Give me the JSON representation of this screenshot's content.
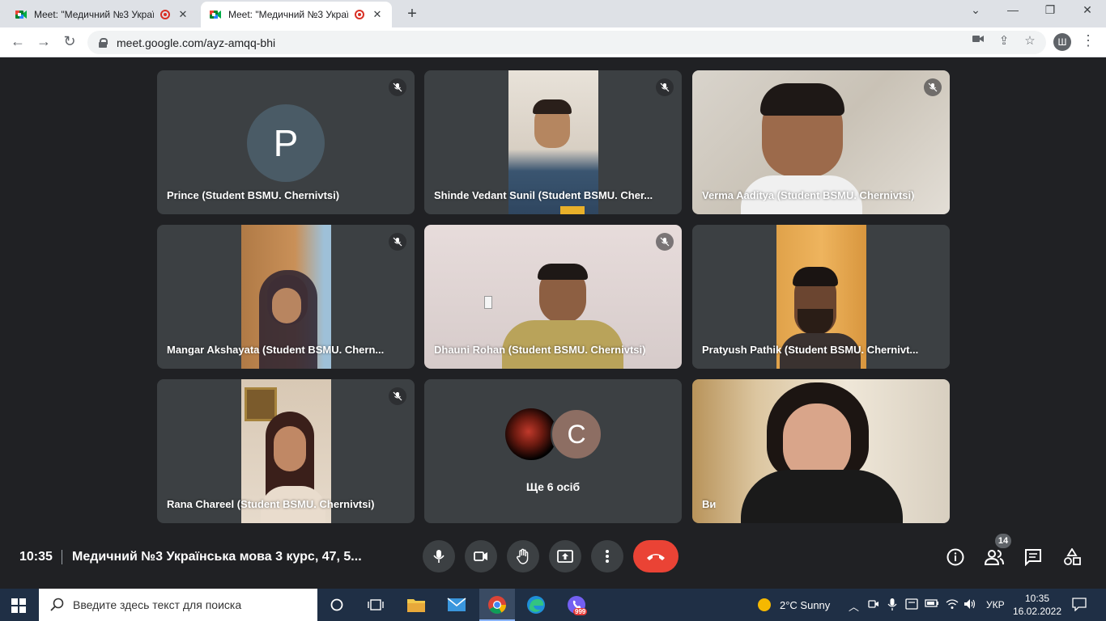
{
  "browser": {
    "tabs": [
      {
        "title": "Meet: \"Медичний №3 Украї"
      },
      {
        "title": "Meet: \"Медичний №3 Украї"
      }
    ],
    "url": "meet.google.com/ayz-amqq-bhi",
    "profile_initial": "Ш"
  },
  "meet": {
    "tiles": [
      {
        "name": "Prince (Student BSMU. Chernivtsi)",
        "avatar": "P",
        "muted": true
      },
      {
        "name": "Shinde Vedant Sunil (Student BSMU. Cher...",
        "muted": true
      },
      {
        "name": "Verma Aaditya (Student BSMU. Chernivtsi)",
        "muted": true
      },
      {
        "name": "Mangar Akshayata (Student BSMU. Chern...",
        "muted": true
      },
      {
        "name": "Dhauni Rohan (Student BSMU. Chernivtsi)",
        "muted": true
      },
      {
        "name": "Pratyush Pathik (Student BSMU. Chernivt...",
        "muted": false
      },
      {
        "name": "Rana Chareel (Student BSMU. Chernivtsi)",
        "muted": true
      },
      {
        "name": "Ще 6 осіб",
        "avatar": "C"
      },
      {
        "name": "Ви"
      }
    ],
    "bottom": {
      "time": "10:35",
      "meeting_title": "Медичний №3 Українська мова 3 курс, 47, 5...",
      "participants_count": "14"
    }
  },
  "taskbar": {
    "search_placeholder": "Введите здесь текст для поиска",
    "weather": "2°C  Sunny",
    "lang": "УКР",
    "time": "10:35",
    "date": "16.02.2022",
    "viber_badge": "999"
  },
  "colors": {
    "meet_bg": "#202124",
    "tile_bg": "#3c4043",
    "hangup": "#ea4335",
    "taskbar": "#1f2f45"
  }
}
